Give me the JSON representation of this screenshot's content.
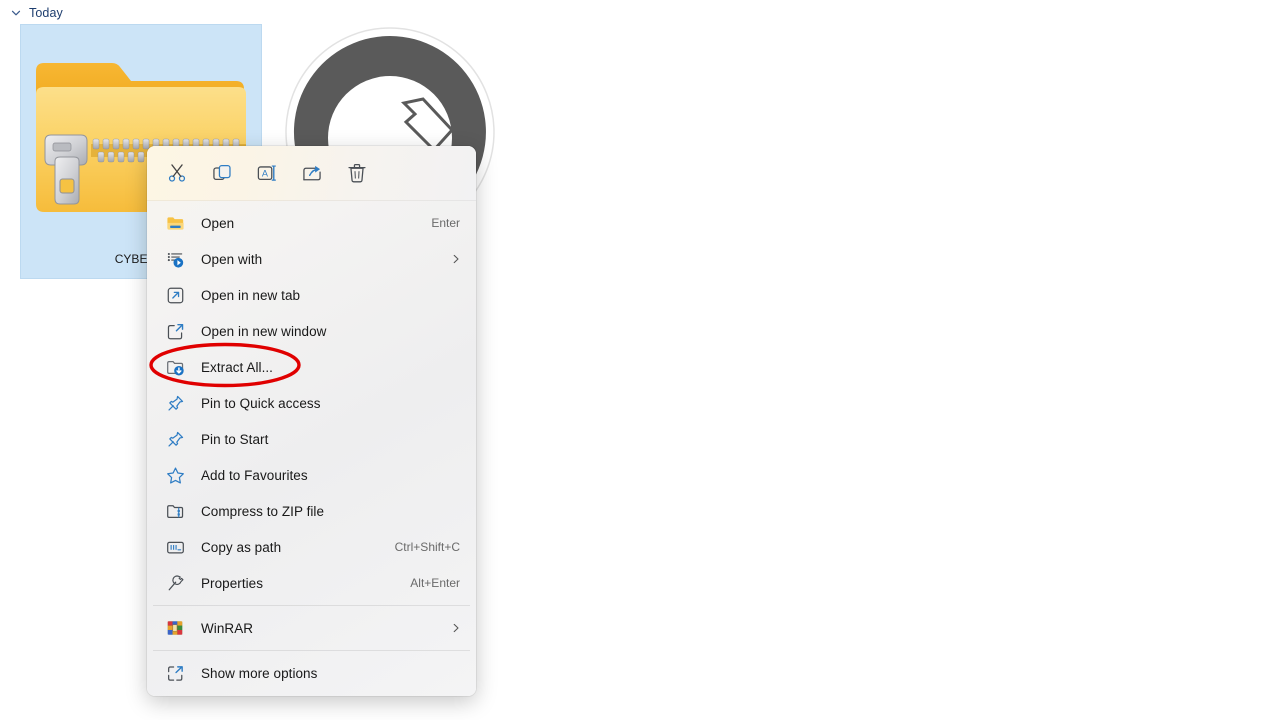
{
  "explorer": {
    "group_header": {
      "label": "Today",
      "chevron_icon": "chevron-down-icon",
      "expanded": true
    },
    "selected_file": {
      "name": "CYBERW",
      "icon": "zipped-folder-icon",
      "selected": true,
      "selection_color": "#cce4f7"
    },
    "background_thumbnail": {
      "icon": "round-dark-disc-icon",
      "color": "#5a5a5a"
    }
  },
  "context_menu": {
    "toolbar": [
      {
        "name": "cut-icon",
        "label": "Cut"
      },
      {
        "name": "copy-icon",
        "label": "Copy"
      },
      {
        "name": "rename-icon",
        "label": "Rename"
      },
      {
        "name": "share-icon",
        "label": "Share"
      },
      {
        "name": "delete-icon",
        "label": "Delete"
      }
    ],
    "items": [
      {
        "label": "Open",
        "shortcut": "Enter",
        "icon": "folder-open-icon",
        "submenu": false
      },
      {
        "label": "Open with",
        "shortcut": "",
        "icon": "open-with-icon",
        "submenu": true
      },
      {
        "label": "Open in new tab",
        "shortcut": "",
        "icon": "new-tab-icon",
        "submenu": false
      },
      {
        "label": "Open in new window",
        "shortcut": "",
        "icon": "new-window-icon",
        "submenu": false
      },
      {
        "label": "Extract All...",
        "shortcut": "",
        "icon": "extract-all-icon",
        "submenu": false,
        "highlighted": true
      },
      {
        "label": "Pin to Quick access",
        "shortcut": "",
        "icon": "pin-icon",
        "submenu": false
      },
      {
        "label": "Pin to Start",
        "shortcut": "",
        "icon": "pin-icon",
        "submenu": false
      },
      {
        "label": "Add to Favourites",
        "shortcut": "",
        "icon": "star-icon",
        "submenu": false
      },
      {
        "label": "Compress to ZIP file",
        "shortcut": "",
        "icon": "compress-zip-icon",
        "submenu": false
      },
      {
        "label": "Copy as path",
        "shortcut": "Ctrl+Shift+C",
        "icon": "copy-as-path-icon",
        "submenu": false
      },
      {
        "label": "Properties",
        "shortcut": "Alt+Enter",
        "icon": "properties-icon",
        "submenu": false
      },
      {
        "label": "WinRAR",
        "shortcut": "",
        "icon": "winrar-icon",
        "submenu": true,
        "separator_before": true
      },
      {
        "label": "Show more options",
        "shortcut": "",
        "icon": "show-more-options-icon",
        "submenu": false,
        "separator_before": true
      }
    ]
  },
  "annotation": {
    "shape": "ellipse",
    "color": "#e00000",
    "targets_item": "Extract All..."
  }
}
